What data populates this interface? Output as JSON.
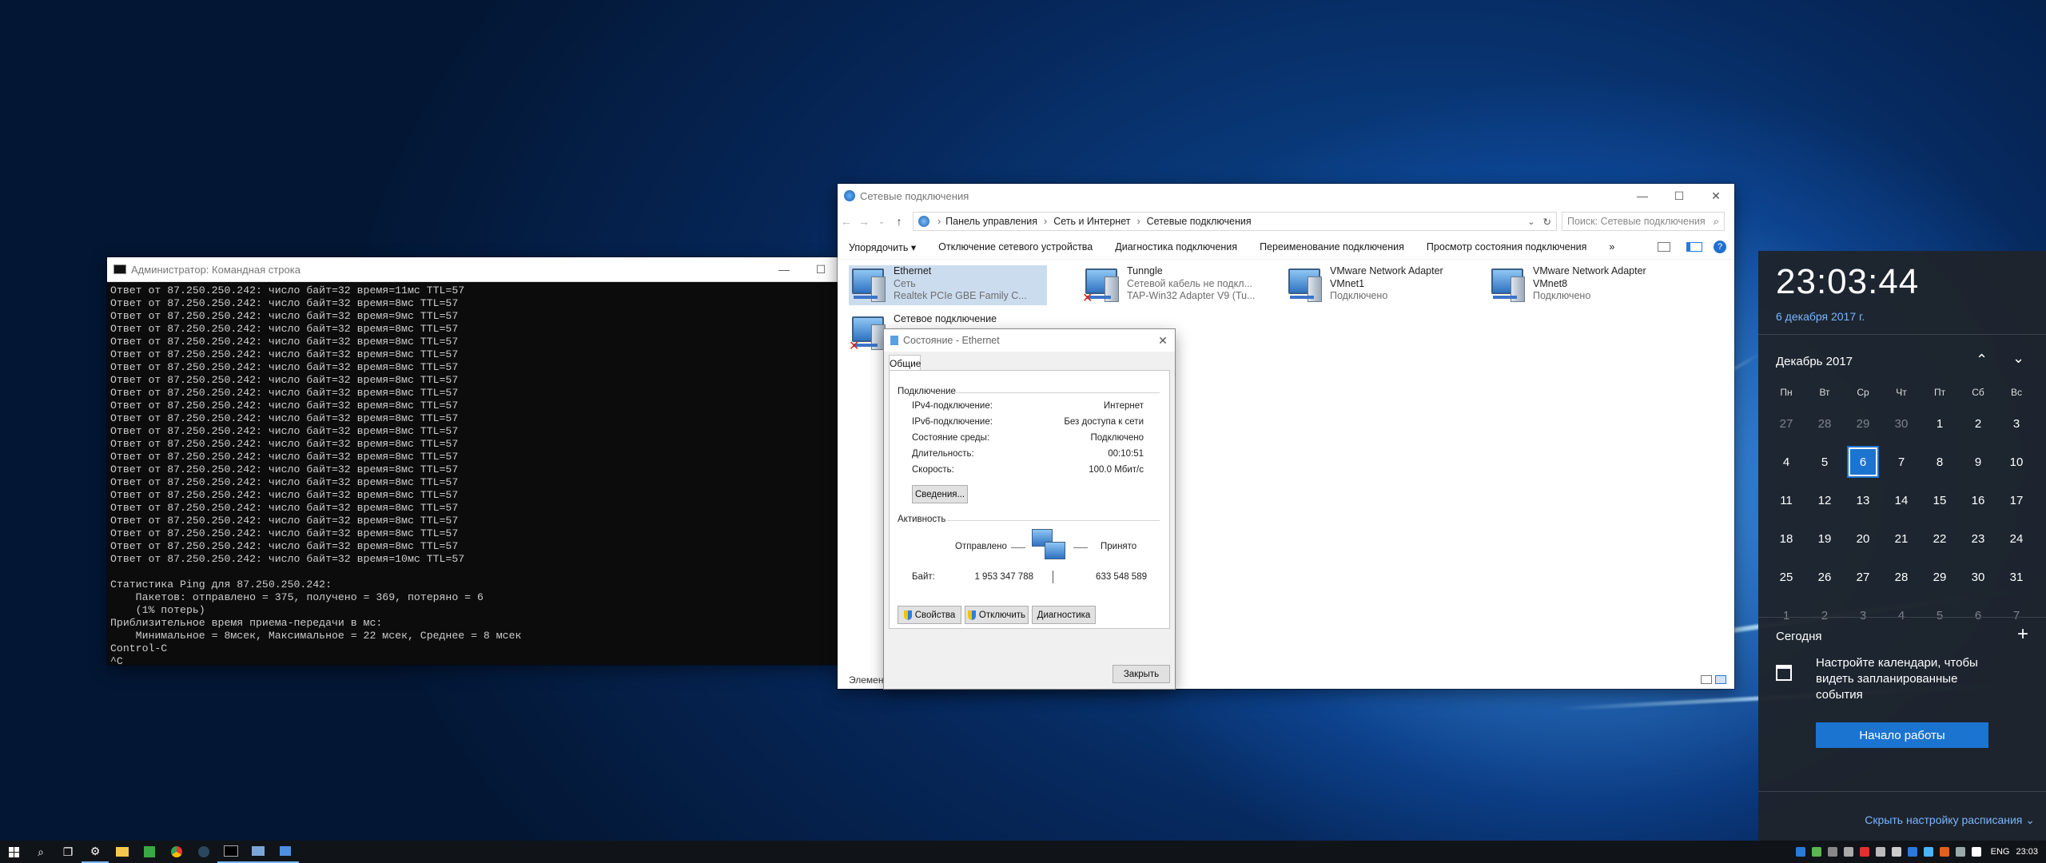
{
  "cmd": {
    "title": "Администратор: Командная строка",
    "lines": [
      "Ответ от 87.250.250.242: число байт=32 время=11мс TTL=57",
      "Ответ от 87.250.250.242: число байт=32 время=8мс TTL=57",
      "Ответ от 87.250.250.242: число байт=32 время=9мс TTL=57",
      "Ответ от 87.250.250.242: число байт=32 время=8мс TTL=57",
      "Ответ от 87.250.250.242: число байт=32 время=8мс TTL=57",
      "Ответ от 87.250.250.242: число байт=32 время=8мс TTL=57",
      "Ответ от 87.250.250.242: число байт=32 время=8мс TTL=57",
      "Ответ от 87.250.250.242: число байт=32 время=8мс TTL=57",
      "Ответ от 87.250.250.242: число байт=32 время=8мс TTL=57",
      "Ответ от 87.250.250.242: число байт=32 время=8мс TTL=57",
      "Ответ от 87.250.250.242: число байт=32 время=8мс TTL=57",
      "Ответ от 87.250.250.242: число байт=32 время=8мс TTL=57",
      "Ответ от 87.250.250.242: число байт=32 время=8мс TTL=57",
      "Ответ от 87.250.250.242: число байт=32 время=8мс TTL=57",
      "Ответ от 87.250.250.242: число байт=32 время=8мс TTL=57",
      "Ответ от 87.250.250.242: число байт=32 время=8мс TTL=57",
      "Ответ от 87.250.250.242: число байт=32 время=8мс TTL=57",
      "Ответ от 87.250.250.242: число байт=32 время=8мс TTL=57",
      "Ответ от 87.250.250.242: число байт=32 время=8мс TTL=57",
      "Ответ от 87.250.250.242: число байт=32 время=8мс TTL=57",
      "Ответ от 87.250.250.242: число байт=32 время=8мс TTL=57",
      "Ответ от 87.250.250.242: число байт=32 время=10мс TTL=57",
      "",
      "Статистика Ping для 87.250.250.242:",
      "    Пакетов: отправлено = 375, получено = 369, потеряно = 6",
      "    (1% потерь)",
      "Приблизительное время приема-передачи в мс:",
      "    Минимальное = 8мсек, Максимальное = 22 мсек, Среднее = 8 мсек",
      "Control-C",
      "^C"
    ]
  },
  "explorer": {
    "title": "Сетевые подключения",
    "breadcrumb": [
      "Панель управления",
      "Сеть и Интернет",
      "Сетевые подключения"
    ],
    "search_placeholder": "Поиск: Сетевые подключения",
    "commands": [
      "Упорядочить ▾",
      "Отключение сетевого устройства",
      "Диагностика подключения",
      "Переименование подключения",
      "Просмотр состояния подключения",
      "»"
    ],
    "adapters": [
      {
        "name": "Ethernet",
        "status": "Сеть",
        "device": "Realtek PCIe GBE Family C..."
      },
      {
        "name": "Tunngle",
        "status": "Сетевой кабель не подкл...",
        "device": "TAP-Win32 Adapter V9 (Tu..."
      },
      {
        "name": "VMware Network Adapter",
        "status": "VMnet1",
        "device": "Подключено"
      },
      {
        "name": "VMware Network Adapter",
        "status": "VMnet8",
        "device": "Подключено"
      },
      {
        "name": "Сетевое подключение",
        "status": "",
        "device": ""
      }
    ],
    "statusbar": "Элемент"
  },
  "dialog": {
    "title": "Состояние - Ethernet",
    "tab": "Общие",
    "connection_header": "Подключение",
    "rows": [
      {
        "label": "IPv4-подключение:",
        "value": "Интернет"
      },
      {
        "label": "IPv6-подключение:",
        "value": "Без доступа к сети"
      },
      {
        "label": "Состояние среды:",
        "value": "Подключено"
      },
      {
        "label": "Длительность:",
        "value": "00:10:51"
      },
      {
        "label": "Скорость:",
        "value": "100.0 Мбит/с"
      }
    ],
    "details_button": "Сведения...",
    "activity_header": "Активность",
    "sent_label": "Отправлено",
    "received_label": "Принято",
    "bytes_label": "Байт:",
    "bytes_sent": "1 953 347 788",
    "bytes_received": "633 548 589",
    "properties_button": "Свойства",
    "disable_button": "Отключить",
    "diagnose_button": "Диагностика",
    "close_button": "Закрыть"
  },
  "calendar": {
    "time": "23:03:44",
    "date": "6 декабря 2017 г.",
    "month": "Декабрь 2017",
    "weekdays": [
      "Пн",
      "Вт",
      "Ср",
      "Чт",
      "Пт",
      "Сб",
      "Вс"
    ],
    "days": [
      "27",
      "28",
      "29",
      "30",
      "1",
      "2",
      "3",
      "4",
      "5",
      "6",
      "7",
      "8",
      "9",
      "10",
      "11",
      "12",
      "13",
      "14",
      "15",
      "16",
      "17",
      "18",
      "19",
      "20",
      "21",
      "22",
      "23",
      "24",
      "25",
      "26",
      "27",
      "28",
      "29",
      "30",
      "31",
      "1",
      "2",
      "3",
      "4",
      "5",
      "6",
      "7"
    ],
    "selected_index": 9,
    "today_label": "Сегодня",
    "calendar_prompt": "Настройте календари, чтобы видеть запланированные события",
    "start_button": "Начало работы",
    "hide_link": "Скрыть настройку расписания"
  },
  "taskbar": {
    "language": "ENG",
    "clock": "23:03"
  }
}
